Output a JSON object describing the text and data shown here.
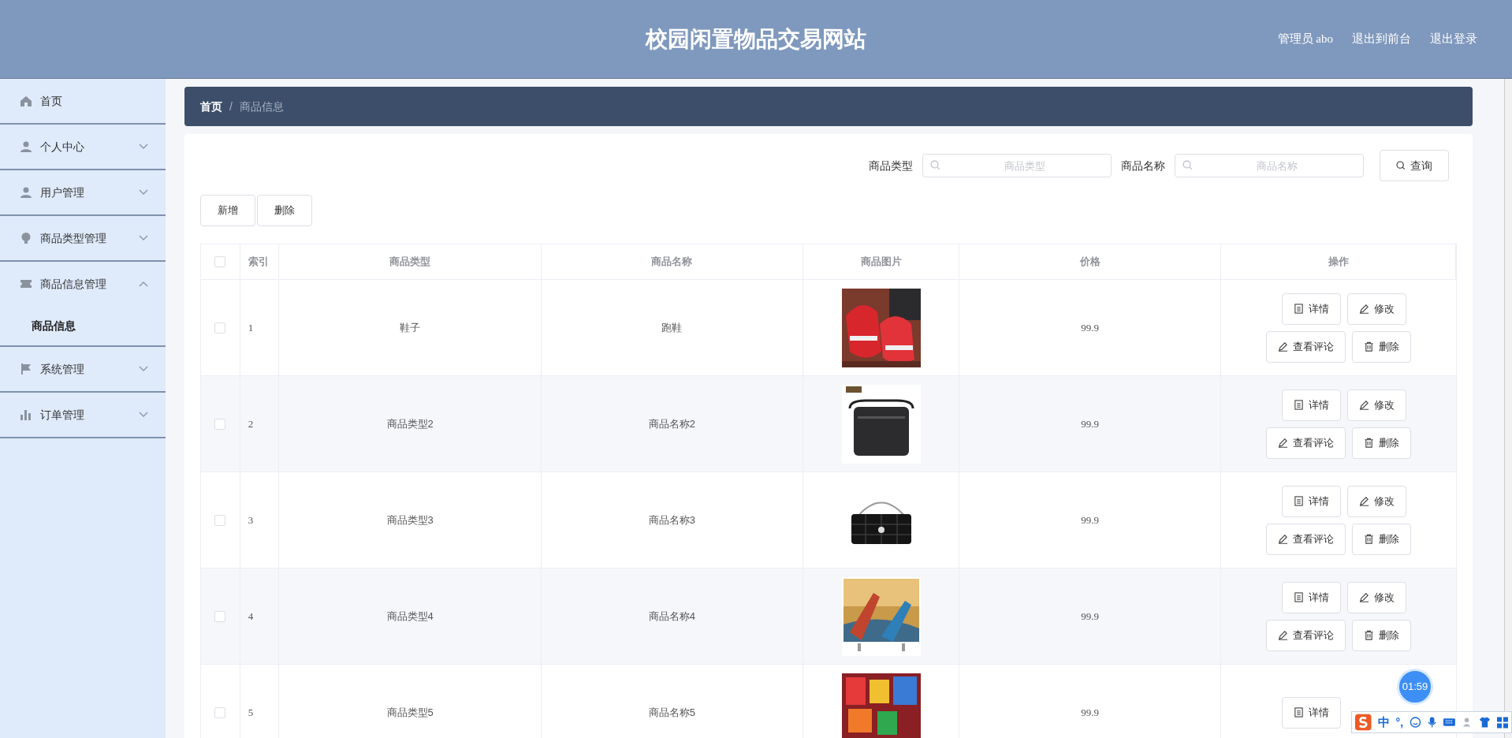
{
  "header": {
    "title": "校园闲置物品交易网站",
    "admin_label": "管理员 abo",
    "links": [
      "退出到前台",
      "退出登录"
    ]
  },
  "sidebar": {
    "items": [
      {
        "kind": "link",
        "label": "首页"
      },
      {
        "kind": "menu",
        "label": "个人中心",
        "expanded": false
      },
      {
        "kind": "menu",
        "label": "用户管理",
        "expanded": false
      },
      {
        "kind": "menu",
        "label": "商品类型管理",
        "expanded": false
      },
      {
        "kind": "menu",
        "label": "商品信息管理",
        "expanded": true,
        "children": [
          {
            "label": "商品信息",
            "selected": true
          }
        ]
      },
      {
        "kind": "menu",
        "label": "系统管理",
        "expanded": false
      },
      {
        "kind": "menu",
        "label": "订单管理",
        "expanded": false
      }
    ]
  },
  "breadcrumb": {
    "items": [
      "首页",
      "商品信息"
    ],
    "separator": "/"
  },
  "search": {
    "fields": [
      {
        "label": "商品类型",
        "placeholder": "商品类型"
      },
      {
        "label": "商品名称",
        "placeholder": "商品名称"
      }
    ],
    "button": "查询"
  },
  "toolbar": {
    "buttons": [
      "新增",
      "删除"
    ]
  },
  "table": {
    "select_all": {
      "checked": false
    },
    "columns": [
      "索引",
      "商品类型",
      "商品名称",
      "商品图片",
      "价格",
      "操作"
    ],
    "rows": [
      {
        "selected": false,
        "index": "1",
        "type": "鞋子",
        "name": "跑鞋",
        "image": {
          "kind": "picture"
        },
        "price": "99.9",
        "actions": [
          "详情",
          "修改",
          "查看评论",
          "删除"
        ]
      },
      {
        "selected": false,
        "index": "2",
        "type": "商品类型2",
        "name": "商品名称2",
        "image": {
          "kind": "picture"
        },
        "price": "99.9",
        "actions": [
          "详情",
          "修改",
          "查看评论",
          "删除"
        ]
      },
      {
        "selected": false,
        "index": "3",
        "type": "商品类型3",
        "name": "商品名称3",
        "image": {
          "kind": "picture"
        },
        "price": "99.9",
        "actions": [
          "详情",
          "修改",
          "查看评论",
          "删除"
        ]
      },
      {
        "selected": false,
        "index": "4",
        "type": "商品类型4",
        "name": "商品名称4",
        "image": {
          "kind": "picture"
        },
        "price": "99.9",
        "actions": [
          "详情",
          "修改",
          "查看评论",
          "删除"
        ]
      },
      {
        "selected": false,
        "index": "5",
        "type": "商品类型5",
        "name": "商品名称5",
        "image": {
          "kind": "picture"
        },
        "price": "99.9",
        "actions": [
          "详情"
        ]
      }
    ]
  },
  "timer": "01:59",
  "ime": {
    "mode": "中",
    "punctuation": "°,"
  }
}
